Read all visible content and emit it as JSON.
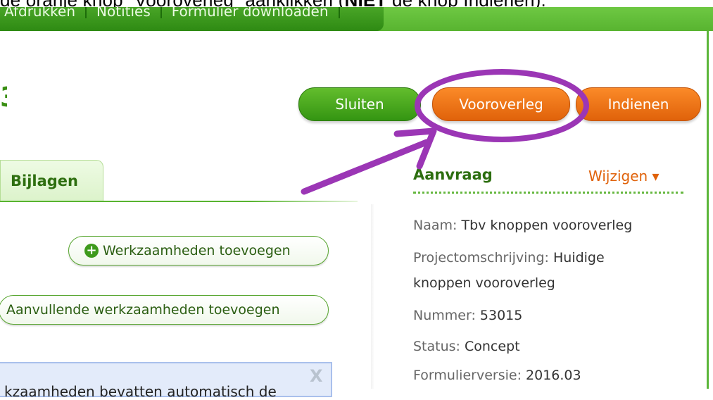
{
  "caption": {
    "part1": "de oranje knop “Vooroverleg” aanklikken (",
    "bold": "NIET",
    "part2": " de knop Indienen)."
  },
  "nav": {
    "items": [
      "Afdrukken",
      "Notities",
      "Formulier downloaden"
    ]
  },
  "title_fragment": "3",
  "buttons": {
    "close": "Sluiten",
    "preconsult": "Vooroverleg",
    "submit": "Indienen"
  },
  "tab": {
    "label": "Bijlagen"
  },
  "actions": {
    "add_work": "Werkzaamheden toevoegen",
    "add_extra_work": "Aanvullende werkzaamheden toevoegen"
  },
  "notice": {
    "text": "kzaamheden bevatten automatisch de",
    "close": "X"
  },
  "sidebar": {
    "heading": "Aanvraag",
    "edit_link": "Wijzigen ▾",
    "fields": {
      "name_label": "Naam:",
      "name_value": "Tbv knoppen vooroverleg",
      "desc_label": "Projectomschrijving:",
      "desc_value_1": "Huidige",
      "desc_value_2": "knoppen vooroverleg",
      "number_label": "Nummer:",
      "number_value": "53015",
      "status_label": "Status:",
      "status_value": "Concept",
      "version_label": "Formulierversie:",
      "version_value": "2016.03"
    }
  },
  "colors": {
    "green": "#3e9a1c",
    "orange": "#f07516",
    "annotation": "#9b36b5"
  }
}
